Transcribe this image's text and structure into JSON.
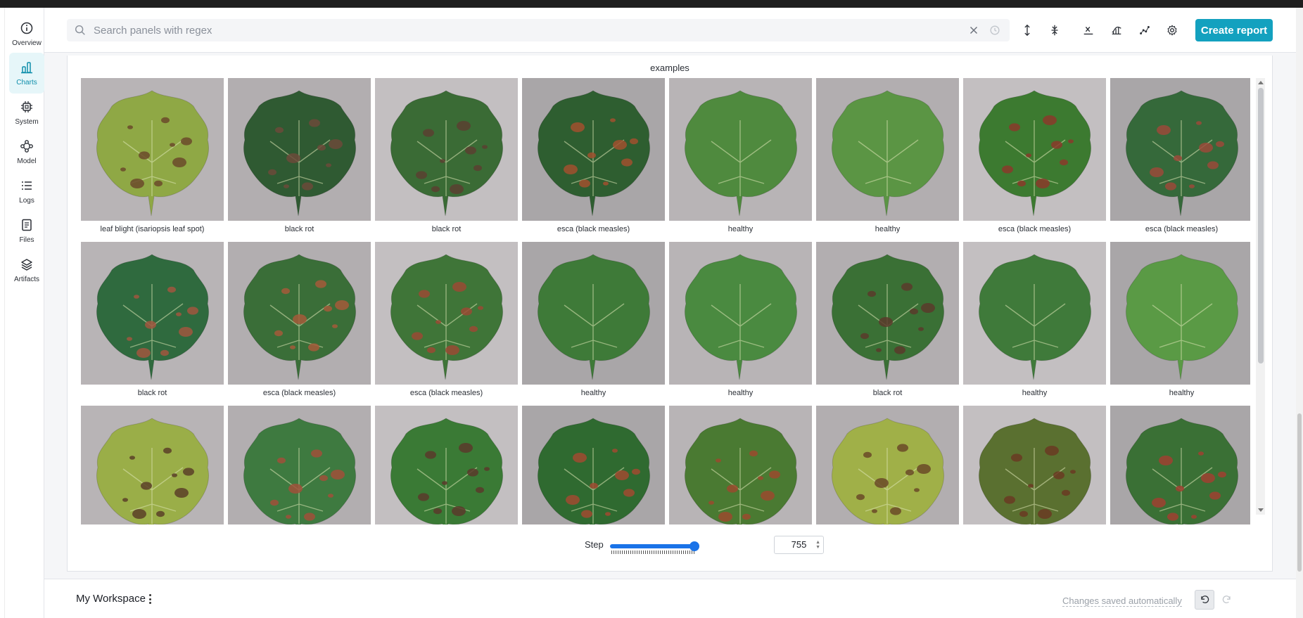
{
  "sidebar": {
    "items": [
      {
        "label": "Overview",
        "icon": "info-icon"
      },
      {
        "label": "Charts",
        "icon": "bar-chart-icon",
        "active": true
      },
      {
        "label": "System",
        "icon": "chip-icon"
      },
      {
        "label": "Model",
        "icon": "network-icon"
      },
      {
        "label": "Logs",
        "icon": "list-icon"
      },
      {
        "label": "Files",
        "icon": "file-icon"
      },
      {
        "label": "Artifacts",
        "icon": "layers-icon"
      }
    ]
  },
  "header": {
    "search_placeholder": "Search panels with regex",
    "search_value": "",
    "create_report_label": "Create report",
    "accent_color": "#13a1bf"
  },
  "panel": {
    "title": "examples",
    "images": [
      {
        "caption": "leaf blight (isariopsis leaf spot)",
        "leaf_color": "#8fa845",
        "spot_color": "#6b4a2a"
      },
      {
        "caption": "black rot",
        "leaf_color": "#2f5a32",
        "spot_color": "#6b4a3a"
      },
      {
        "caption": "black rot",
        "leaf_color": "#3a6b35",
        "spot_color": "#5a4030"
      },
      {
        "caption": "esca (black measles)",
        "leaf_color": "#2e5e30",
        "spot_color": "#a0502e"
      },
      {
        "caption": "healthy",
        "leaf_color": "#4f8a3e",
        "spot_color": ""
      },
      {
        "caption": "healthy",
        "leaf_color": "#5b9544",
        "spot_color": ""
      },
      {
        "caption": "esca (black measles)",
        "leaf_color": "#3c7a30",
        "spot_color": "#8a3a2a"
      },
      {
        "caption": "esca (black measles)",
        "leaf_color": "#35693a",
        "spot_color": "#9a4a3a"
      },
      {
        "caption": "black rot",
        "leaf_color": "#2f6a3e",
        "spot_color": "#a0563e"
      },
      {
        "caption": "esca (black measles)",
        "leaf_color": "#3a6e38",
        "spot_color": "#a55a3a"
      },
      {
        "caption": "esca (black measles)",
        "leaf_color": "#3f7538",
        "spot_color": "#9a4a34"
      },
      {
        "caption": "healthy",
        "leaf_color": "#3e7a38",
        "spot_color": ""
      },
      {
        "caption": "healthy",
        "leaf_color": "#4a8a40",
        "spot_color": ""
      },
      {
        "caption": "black rot",
        "leaf_color": "#3a7035",
        "spot_color": "#5a3a2a"
      },
      {
        "caption": "healthy",
        "leaf_color": "#3f7a3a",
        "spot_color": ""
      },
      {
        "caption": "healthy",
        "leaf_color": "#5a9a45",
        "spot_color": ""
      },
      {
        "caption": "",
        "leaf_color": "#9aae48",
        "spot_color": "#5a4028"
      },
      {
        "caption": "",
        "leaf_color": "#3e7a40",
        "spot_color": "#a0503a"
      },
      {
        "caption": "",
        "leaf_color": "#3a7a35",
        "spot_color": "#5a3a2a"
      },
      {
        "caption": "",
        "leaf_color": "#2f6a30",
        "spot_color": "#a04a30"
      },
      {
        "caption": "",
        "leaf_color": "#4a7a32",
        "spot_color": "#9a4a2e"
      },
      {
        "caption": "",
        "leaf_color": "#a0b048",
        "spot_color": "#6a4a28"
      },
      {
        "caption": "",
        "leaf_color": "#5a7030",
        "spot_color": "#6a3a22"
      },
      {
        "caption": "",
        "leaf_color": "#3a7035",
        "spot_color": "#a04030"
      }
    ]
  },
  "step": {
    "label": "Step",
    "value": "755",
    "slider_fraction": 1.0
  },
  "footer": {
    "workspace_title": "My Workspace",
    "saved_text": "Changes saved automatically"
  }
}
